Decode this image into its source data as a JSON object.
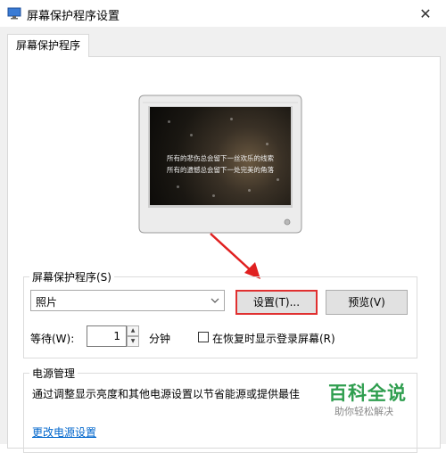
{
  "window": {
    "title": "屏幕保护程序设置",
    "close_glyph": "✕"
  },
  "tab": {
    "label": "屏幕保护程序"
  },
  "preview": {
    "caption_line1": "所有的悲伤总会留下一丝欢乐的线索",
    "caption_line2": "所有的遗憾总会留下一处完美的角落"
  },
  "screensaver": {
    "group_label": "屏幕保护程序(S)",
    "selected": "照片",
    "settings_label": "设置(T)...",
    "preview_label": "预览(V)",
    "wait_label": "等待(W):",
    "wait_value": "1",
    "minutes_label": "分钟",
    "resume_checkbox_label": "在恢复时显示登录屏幕(R)",
    "resume_checked": false
  },
  "power": {
    "group_label": "电源管理",
    "description": "通过调整显示亮度和其他电源设置以节省能源或提供最佳",
    "link_label": "更改电源设置"
  },
  "watermark": {
    "main": "百科全说",
    "sub": "助你轻松解决"
  },
  "colors": {
    "highlight": "#e03030",
    "link": "#0066cc",
    "watermark": "#2f9e4f"
  }
}
